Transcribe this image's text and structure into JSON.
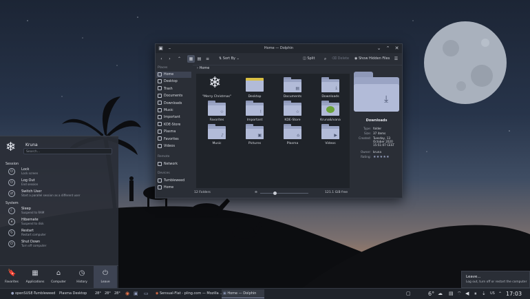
{
  "colors": {
    "accent": "#8e98b8",
    "panel": "#2a2e36",
    "taskbar": "#20242b"
  },
  "window": {
    "title": "Home — Dolphin",
    "toolbar": {
      "sort_label": "Sort By",
      "split_label": "Split",
      "delete_label": "Delete",
      "hidden_label": "Show Hidden Files"
    },
    "places": {
      "header": "Places",
      "items": [
        {
          "label": "Home",
          "icon": "home-icon"
        },
        {
          "label": "Desktop",
          "icon": "desktop-icon"
        },
        {
          "label": "Trash",
          "icon": "trash-icon"
        },
        {
          "label": "Documents",
          "icon": "documents-icon"
        },
        {
          "label": "Downloads",
          "icon": "downloads-icon"
        },
        {
          "label": "Music",
          "icon": "music-icon"
        },
        {
          "label": "Important",
          "icon": "important-icon"
        },
        {
          "label": "KDE-Store",
          "icon": "store-icon"
        },
        {
          "label": "Plasma",
          "icon": "folder-icon"
        },
        {
          "label": "Favorites",
          "icon": "star-icon"
        },
        {
          "label": "Videos",
          "icon": "videos-icon"
        }
      ],
      "remote_header": "Remote",
      "remote_items": [
        {
          "label": "Network",
          "icon": "network-icon"
        }
      ],
      "devices_header": "Devices",
      "device_items": [
        {
          "label": "Tumbleweed",
          "icon": "drive-icon"
        },
        {
          "label": "Home",
          "icon": "drive-icon"
        }
      ]
    },
    "breadcrumb": "Home",
    "files": [
      {
        "label": "\"Merry Christmas\"",
        "kind": "snowflake",
        "glyph": "❄"
      },
      {
        "label": "Desktop",
        "kind": "desktop",
        "glyph": ""
      },
      {
        "label": "Documents",
        "kind": "folder",
        "glyph": "▤"
      },
      {
        "label": "Downloads",
        "kind": "folder",
        "glyph": "⤓"
      },
      {
        "label": "Favorites",
        "kind": "folder",
        "glyph": "☆"
      },
      {
        "label": "Important",
        "kind": "folder",
        "glyph": "!"
      },
      {
        "label": "KDE-Store",
        "kind": "folder",
        "glyph": "☆"
      },
      {
        "label": "Kruna&Ivana",
        "kind": "image",
        "glyph": ""
      },
      {
        "label": "Music",
        "kind": "folder",
        "glyph": "♪"
      },
      {
        "label": "Pictures",
        "kind": "folder",
        "glyph": "▣"
      },
      {
        "label": "Plasma",
        "kind": "folder",
        "glyph": "⌂"
      },
      {
        "label": "Videos",
        "kind": "folder",
        "glyph": "▶"
      }
    ],
    "status": {
      "folders": "12 Folders",
      "free": "121.1 GiB free",
      "zoom": 0.3
    },
    "info": {
      "name": "Downloads",
      "fields": [
        {
          "k": "Type:",
          "v": "folder"
        },
        {
          "k": "Size:",
          "v": "37 items"
        },
        {
          "k": "Created:",
          "v": "Tuesday, 13 October 2020 15:51:07 CEST"
        },
        {
          "k": "Owner:",
          "v": "kruna"
        },
        {
          "k": "Rating:",
          "v": "★★★★★"
        }
      ],
      "rating": 5
    }
  },
  "launcher": {
    "user": "Kruna",
    "search_placeholder": "Search...",
    "session_header": "Session",
    "session": [
      {
        "title": "Lock",
        "sub": "Lock screen",
        "glyph": "⏻"
      },
      {
        "title": "Log Out",
        "sub": "End session",
        "glyph": "⏻"
      },
      {
        "title": "Switch User",
        "sub": "Start a parallel session as a different user",
        "glyph": "⇄"
      }
    ],
    "system_header": "System",
    "system": [
      {
        "title": "Sleep",
        "sub": "Suspend to RAM",
        "glyph": "☾"
      },
      {
        "title": "Hibernate",
        "sub": "Suspend to disk",
        "glyph": "⏸"
      },
      {
        "title": "Restart",
        "sub": "Restart computer",
        "glyph": "↻"
      },
      {
        "title": "Shut Down",
        "sub": "Turn off computer",
        "glyph": "⏻"
      }
    ],
    "tabs": [
      {
        "label": "Favorites",
        "glyph": "🔖"
      },
      {
        "label": "Applications",
        "glyph": "▦"
      },
      {
        "label": "Computer",
        "glyph": "⌂"
      },
      {
        "label": "History",
        "glyph": "◷"
      },
      {
        "label": "Leave",
        "glyph": "⏻"
      }
    ]
  },
  "tooltip": {
    "title": "Leave...",
    "desc": "Log out, turn off or restart the computer"
  },
  "taskbar": {
    "menu_label": "openSUSE-Tumbleweed",
    "desktop_label": "Plasma Desktop",
    "temps": [
      "28°",
      "28°",
      "28°"
    ],
    "tasks": [
      "Sensual-Flat - pling.com — Mozilla ...",
      "Home — Dolphin"
    ],
    "weather": "6°",
    "keyboard": "US",
    "time": "17:03"
  }
}
